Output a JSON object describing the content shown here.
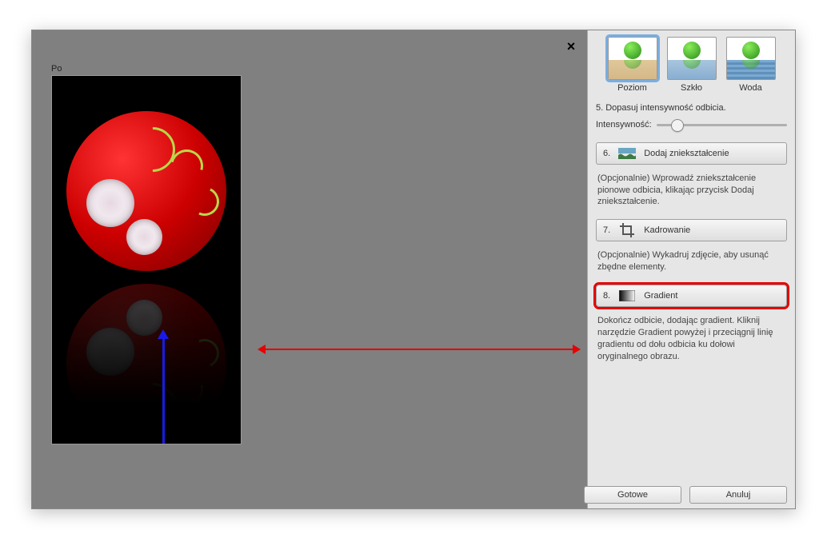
{
  "preview": {
    "label": "Po"
  },
  "reflect_options": [
    {
      "label": "Poziom",
      "selected": true
    },
    {
      "label": "Szkło",
      "selected": false
    },
    {
      "label": "Woda",
      "selected": false
    }
  ],
  "step5_text": "5. Dopasuj intensywność odbicia.",
  "intensity": {
    "label": "Intensywność:",
    "value_pct": 15
  },
  "step6": {
    "num": "6.",
    "label": "Dodaj zniekształcenie"
  },
  "step6_desc": "(Opcjonalnie) Wprowadź zniekształcenie pionowe odbicia, klikając przycisk Dodaj zniekształcenie.",
  "step7": {
    "num": "7.",
    "label": "Kadrowanie"
  },
  "step7_desc": "(Opcjonalnie) Wykadruj zdjęcie, aby usunąć zbędne elementy.",
  "step8": {
    "num": "8.",
    "label": "Gradient"
  },
  "step8_desc": "Dokończ odbicie, dodając gradient. Kliknij narzędzie Gradient powyżej i przeciągnij linię gradientu od dołu odbicia ku dołowi oryginalnego obrazu.",
  "buttons": {
    "done": "Gotowe",
    "cancel": "Anuluj"
  }
}
